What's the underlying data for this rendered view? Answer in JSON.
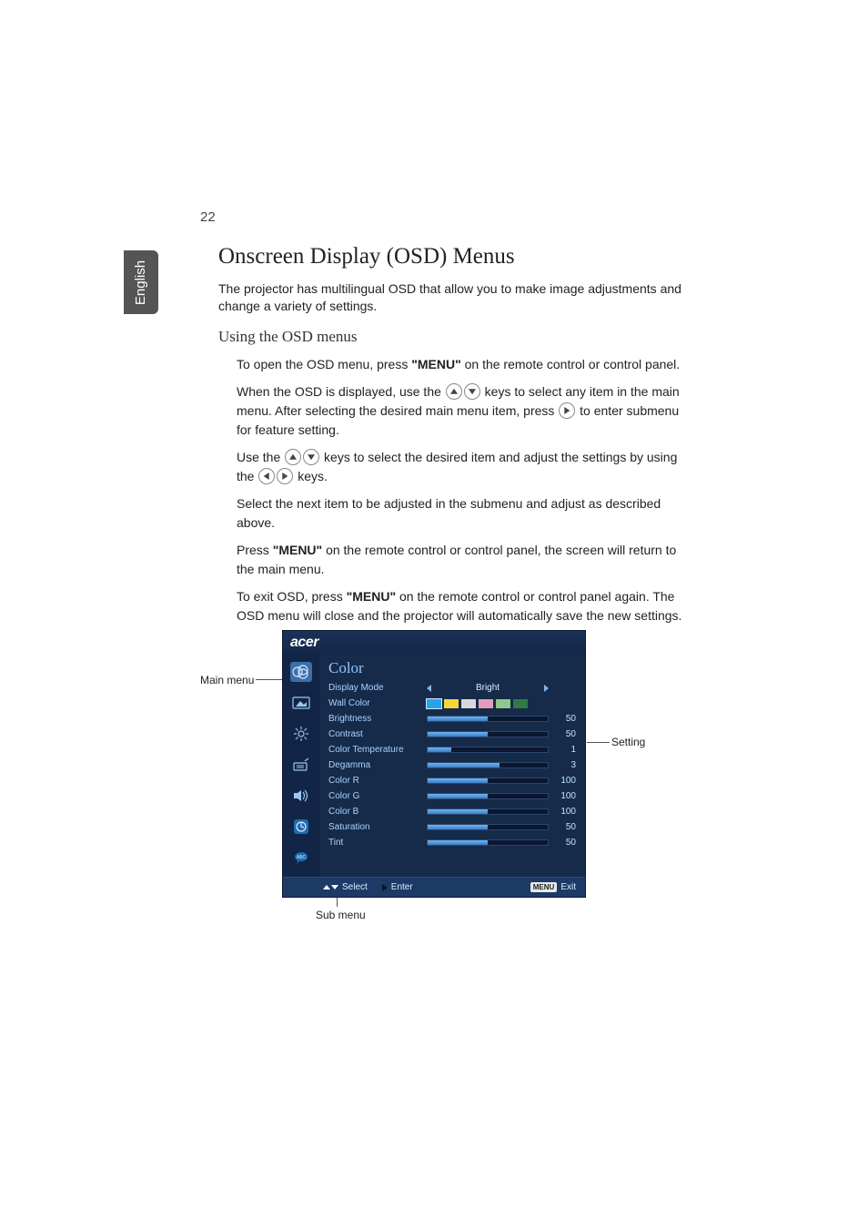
{
  "page_number": "22",
  "language": "English",
  "heading": "Onscreen Display (OSD) Menus",
  "intro": "The projector has multilingual OSD that allow you to make image adjustments and change a variety of settings.",
  "subheading": "Using the OSD menus",
  "b1a": "To open the OSD menu, press ",
  "b1b": "\"MENU\"",
  "b1c": " on the remote control or control panel.",
  "b2a": "When the OSD is displayed, use the ",
  "b2b": " keys to select any item in the main menu. After selecting the desired main menu item, press ",
  "b2c": " to enter submenu for feature setting.",
  "b3a": "Use the ",
  "b3b": " keys to select the desired item and adjust the settings by using the ",
  "b3c": " keys.",
  "b4": "Select the next item to be adjusted in the submenu and adjust as described above.",
  "b5a": "Press ",
  "b5b": "\"MENU\"",
  "b5c": " on the remote control or control panel, the screen will return to the main menu.",
  "b6a": "To exit OSD, press ",
  "b6b": "\"MENU\"",
  "b6c": " on the remote control or control panel again. The OSD menu will close and the projector will automatically save the new settings.",
  "labels": {
    "main_menu": "Main menu",
    "setting": "Setting",
    "sub_menu": "Sub menu"
  },
  "osd": {
    "brand": "acer",
    "title": "Color",
    "display_mode": {
      "label": "Display Mode",
      "value": "Bright"
    },
    "wall_color": {
      "label": "Wall Color"
    },
    "sliders": [
      {
        "label": "Brightness",
        "value": "50",
        "pct": 50
      },
      {
        "label": "Contrast",
        "value": "50",
        "pct": 50
      },
      {
        "label": "Color Temperature",
        "value": "1",
        "pct": 20
      },
      {
        "label": "Degamma",
        "value": "3",
        "pct": 60
      },
      {
        "label": "Color R",
        "value": "100",
        "pct": 50
      },
      {
        "label": "Color G",
        "value": "100",
        "pct": 50
      },
      {
        "label": "Color B",
        "value": "100",
        "pct": 50
      },
      {
        "label": "Saturation",
        "value": "50",
        "pct": 50
      },
      {
        "label": "Tint",
        "value": "50",
        "pct": 50
      }
    ],
    "swatches": [
      "#2aa3e8",
      "#f2d83a",
      "#d9d9d9",
      "#e39dbb",
      "#8dc98d",
      "#2f7a46"
    ],
    "footer": {
      "select": "Select",
      "enter": "Enter",
      "menu": "MENU",
      "exit": "Exit"
    }
  }
}
